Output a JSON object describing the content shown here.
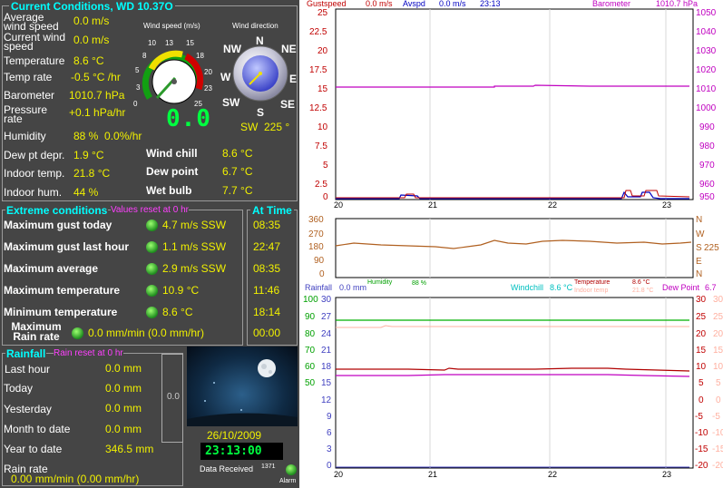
{
  "current": {
    "title": "Current Conditions, WD 10.37O",
    "rows": [
      {
        "label": "Average wind speed",
        "value": "0.0 m/s"
      },
      {
        "label": "Current wind speed",
        "value": "0.0 m/s"
      },
      {
        "label": "Temperature",
        "value": "8.6 °C"
      },
      {
        "label": "Temp rate",
        "value": "-0.5 °C /hr"
      },
      {
        "label": "Barometer",
        "value": "1010.7 hPa"
      },
      {
        "label": "Pressure rate",
        "value": "+0.1 hPa/hr"
      },
      {
        "label": "Humidity",
        "value": "88 %  0.0%/hr"
      },
      {
        "label": "Dew pt depr.",
        "value": "1.9 °C"
      },
      {
        "label": "Indoor temp.",
        "value": "21.8 °C"
      },
      {
        "label": "Indoor hum.",
        "value": "44 %"
      }
    ],
    "right_rows": [
      {
        "label": "Wind chill",
        "value": "8.6 °C"
      },
      {
        "label": "Dew point",
        "value": "6.7 °C"
      },
      {
        "label": "Wet bulb",
        "value": "7.7 °C"
      }
    ],
    "gauge": {
      "title": "Wind speed (m/s)",
      "ticks": [
        "0",
        "3",
        "5",
        "8",
        "10",
        "13",
        "15",
        "18",
        "20",
        "23",
        "25"
      ],
      "digital": "0.0",
      "value": 0
    },
    "compass": {
      "title": "Wind direction",
      "labels": {
        "n": "N",
        "ne": "NE",
        "e": "E",
        "se": "SE",
        "s": "S",
        "sw": "SW",
        "w": "W",
        "nw": "NW"
      },
      "readout": "SW  225 °",
      "degrees": 225
    }
  },
  "extremes": {
    "title": "Extreme conditions",
    "note": "Values reset at 0 hr",
    "at_time_title": "At Time",
    "rows": [
      {
        "label": "Maximum gust today",
        "value": "4.7 m/s SSW",
        "time": "08:35"
      },
      {
        "label": "Maximum gust last hour",
        "value": "1.1 m/s SSW",
        "time": "22:47"
      },
      {
        "label": "Maximum average",
        "value": "2.9 m/s SSW",
        "time": "08:35"
      },
      {
        "label": "Maximum temperature",
        "value": "10.9 °C",
        "time": "11:46"
      },
      {
        "label": "Minimum temperature",
        "value": "8.6 °C",
        "time": "18:14"
      },
      {
        "label": "Maximum Rain rate",
        "value": "0.0 mm/min (0.0 mm/hr)",
        "time": "00:00"
      }
    ]
  },
  "rainfall": {
    "title": "Rainfall",
    "note": "Rain reset at 0 hr",
    "rows": [
      {
        "label": "Last hour",
        "value": "0.0 mm"
      },
      {
        "label": "Today",
        "value": "0.0 mm"
      },
      {
        "label": "Yesterday",
        "value": "0.0 mm"
      },
      {
        "label": "Month to date",
        "value": "0.0 mm"
      },
      {
        "label": "Year to date",
        "value": "346.5 mm"
      }
    ],
    "rate_label": "Rain rate",
    "rate_value": "0.00 mm/min (0.00 mm/hr)",
    "gauge_value": "0.0"
  },
  "status": {
    "date": "26/10/2009",
    "time": "23:13:00",
    "data_received_label": "Data Received",
    "data_received_count": "1371",
    "alarm_label": "Alarm"
  },
  "graph1": {
    "legend": {
      "gust_label": "Gustspeed",
      "gust_value": "0.0 m/s",
      "avspd_label": "Avspd",
      "avspd_value": "0.0 m/s",
      "time": "23:13",
      "baro_label": "Barometer",
      "baro_value": "1010.7 hPa"
    },
    "left_ticks": [
      "25",
      "22.5",
      "20",
      "17.5",
      "15",
      "12.5",
      "10",
      "7.5",
      "5",
      "2.5",
      "0"
    ],
    "right_ticks": [
      "1050",
      "1040",
      "1030",
      "1020",
      "1010",
      "1000",
      "990",
      "980",
      "970",
      "960",
      "950"
    ],
    "x_ticks": [
      "20",
      "21",
      "22",
      "23"
    ]
  },
  "graph2": {
    "left_ticks": [
      "360",
      "270",
      "180",
      "90",
      "0"
    ],
    "right_labels": [
      "N",
      "W",
      "S",
      "E",
      "N"
    ],
    "right_value": "225",
    "x_ticks": [
      "20",
      "21",
      "22",
      "23"
    ]
  },
  "graph3": {
    "legend": {
      "rain_label": "Rainfall",
      "rain_value": "0.0 mm",
      "hum_label": "Humidity",
      "hum_value": "88 %",
      "wc_label": "Windchill",
      "wc_value": "8.6 °C",
      "temp_label": "Temperature",
      "temp_value": "8.6 °C",
      "indoor_label": "Indoor temp",
      "indoor_value": "21.8 °C",
      "dew_label": "Dew Point",
      "dew_value": "6.7"
    },
    "left_a_ticks": [
      "100",
      "90",
      "80",
      "70",
      "60",
      "50"
    ],
    "left_b_ticks": [
      "30",
      "27",
      "24",
      "21",
      "18",
      "15",
      "12",
      "9",
      "6",
      "3",
      "0"
    ],
    "right_ticks": [
      "30",
      "25",
      "20",
      "15",
      "10",
      "5",
      "0",
      "-5",
      "-10",
      "-15",
      "-20"
    ],
    "right_b_ticks": [
      "30",
      "25",
      "20",
      "15",
      "10",
      "5",
      "0",
      "-5",
      "-10",
      "-15",
      "-20"
    ],
    "x_ticks": [
      "20",
      "21",
      "22",
      "23"
    ]
  },
  "colors": {
    "panel_bg": "#454545",
    "label": "#ffffff",
    "value": "#f0f000",
    "header": "#00ffff",
    "note": "#ff40ff",
    "gust": "#c00000",
    "avspd": "#0000c0",
    "barometer": "#c000c0",
    "direction": "#b06020",
    "temperature": "#b00000",
    "humidity": "#00b000",
    "indoor": "#ffb0a0"
  }
}
